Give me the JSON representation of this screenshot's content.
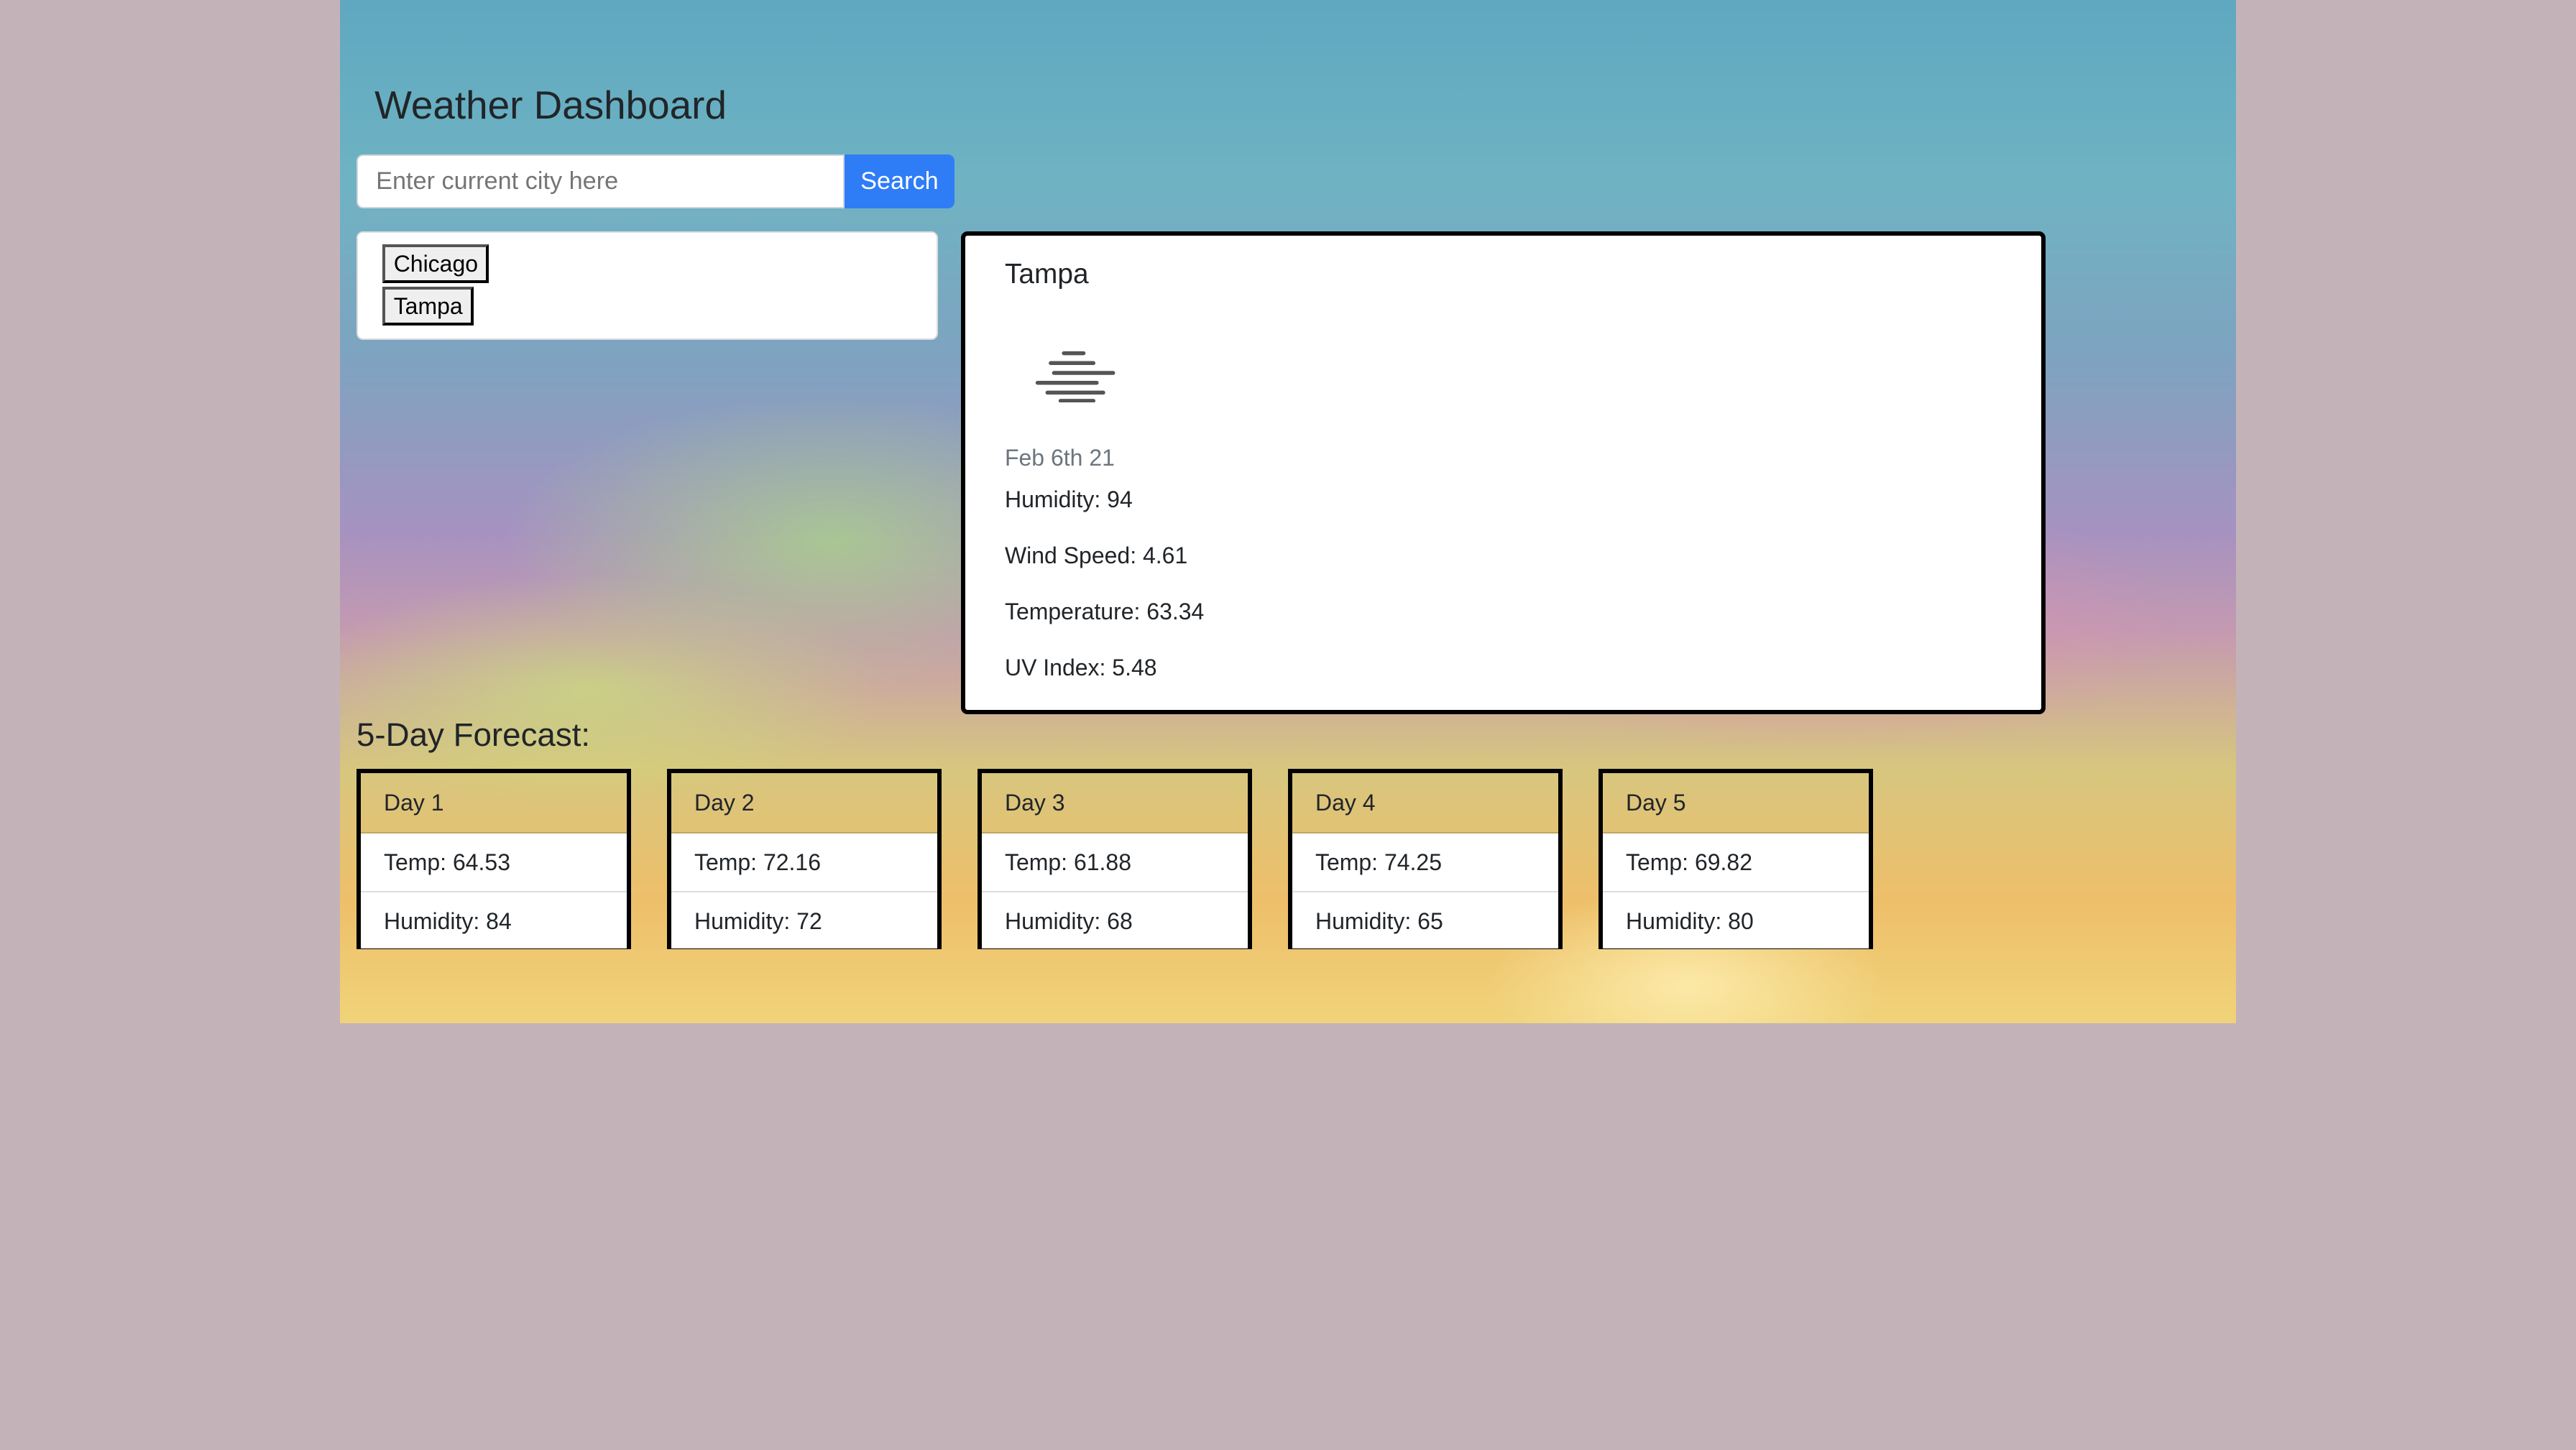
{
  "header": {
    "title": "Weather Dashboard"
  },
  "search": {
    "placeholder": "Enter current city here",
    "value": "",
    "button": "Search"
  },
  "history": [
    "Chicago",
    "Tampa"
  ],
  "current": {
    "city": "Tampa",
    "icon": "mist-icon",
    "date": "Feb 6th 21",
    "humidity": "Humidity: 94",
    "wind": "Wind Speed: 4.61",
    "temp": "Temperature: 63.34",
    "uv": "UV Index: 5.48"
  },
  "forecast": {
    "title": "5-Day Forecast:",
    "days": [
      {
        "label": "Day 1",
        "temp": "Temp: 64.53",
        "humidity": "Humidity: 84"
      },
      {
        "label": "Day 2",
        "temp": "Temp: 72.16",
        "humidity": "Humidity: 72"
      },
      {
        "label": "Day 3",
        "temp": "Temp: 61.88",
        "humidity": "Humidity: 68"
      },
      {
        "label": "Day 4",
        "temp": "Temp: 74.25",
        "humidity": "Humidity: 65"
      },
      {
        "label": "Day 5",
        "temp": "Temp: 69.82",
        "humidity": "Humidity: 80"
      }
    ]
  },
  "colors": {
    "accent": "#2f7df6",
    "page_bg": "#c3b3b9"
  }
}
